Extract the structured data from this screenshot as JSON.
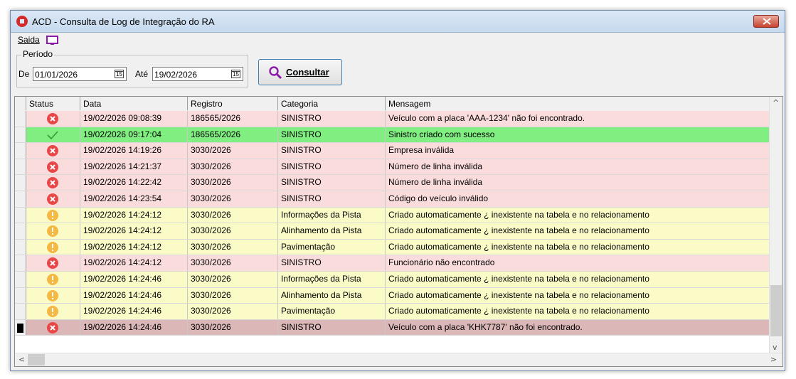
{
  "window": {
    "title": "ACD - Consulta de Log de Integração do RA"
  },
  "menu": {
    "saida_label": "Saida"
  },
  "periodo": {
    "label": "Período",
    "de_label": "De",
    "de_value": "01/01/2026",
    "ate_label": "Até",
    "ate_value": "19/02/2026",
    "calendar_icon_text": "15"
  },
  "consultar": {
    "label": "Consultar"
  },
  "grid": {
    "columns": [
      "Status",
      "Data",
      "Registro",
      "Categoria",
      "Mensagem"
    ],
    "rows": [
      {
        "status": "error",
        "data": "19/02/2026 09:08:39",
        "registro": "186565/2026",
        "categoria": "SINISTRO",
        "mensagem": "Veículo com a placa 'AAA-1234' não foi encontrado."
      },
      {
        "status": "success",
        "data": "19/02/2026 09:17:04",
        "registro": "186565/2026",
        "categoria": "SINISTRO",
        "mensagem": "Sinistro criado com sucesso"
      },
      {
        "status": "error",
        "data": "19/02/2026 14:19:26",
        "registro": "3030/2026",
        "categoria": "SINISTRO",
        "mensagem": "Empresa inválida"
      },
      {
        "status": "error",
        "data": "19/02/2026 14:21:37",
        "registro": "3030/2026",
        "categoria": "SINISTRO",
        "mensagem": "Número de linha inválida"
      },
      {
        "status": "error",
        "data": "19/02/2026 14:22:42",
        "registro": "3030/2026",
        "categoria": "SINISTRO",
        "mensagem": "Número de linha inválida"
      },
      {
        "status": "error",
        "data": "19/02/2026 14:23:54",
        "registro": "3030/2026",
        "categoria": "SINISTRO",
        "mensagem": "Código do veículo inválido"
      },
      {
        "status": "warning",
        "data": "19/02/2026 14:24:12",
        "registro": "3030/2026",
        "categoria": "Informações da Pista",
        "mensagem": "Criado automaticamente ¿ inexistente na tabela e no relacionamento"
      },
      {
        "status": "warning",
        "data": "19/02/2026 14:24:12",
        "registro": "3030/2026",
        "categoria": "Alinhamento da Pista",
        "mensagem": "Criado automaticamente ¿ inexistente na tabela e no relacionamento"
      },
      {
        "status": "warning",
        "data": "19/02/2026 14:24:12",
        "registro": "3030/2026",
        "categoria": "Pavimentação",
        "mensagem": "Criado automaticamente ¿ inexistente na tabela e no relacionamento"
      },
      {
        "status": "error",
        "data": "19/02/2026 14:24:12",
        "registro": "3030/2026",
        "categoria": "SINISTRO",
        "mensagem": "Funcionário não encontrado"
      },
      {
        "status": "warning",
        "data": "19/02/2026 14:24:46",
        "registro": "3030/2026",
        "categoria": "Informações da Pista",
        "mensagem": "Criado automaticamente ¿ inexistente na tabela e no relacionamento"
      },
      {
        "status": "warning",
        "data": "19/02/2026 14:24:46",
        "registro": "3030/2026",
        "categoria": "Alinhamento da Pista",
        "mensagem": "Criado automaticamente ¿ inexistente na tabela e no relacionamento"
      },
      {
        "status": "warning",
        "data": "19/02/2026 14:24:46",
        "registro": "3030/2026",
        "categoria": "Pavimentação",
        "mensagem": "Criado automaticamente ¿ inexistente na tabela e no relacionamento"
      },
      {
        "status": "error",
        "data": "19/02/2026 14:24:46",
        "registro": "3030/2026",
        "categoria": "SINISTRO",
        "mensagem": "Veículo com a placa 'KHK7787' não foi encontrado.",
        "selected": true
      }
    ]
  },
  "colors": {
    "error_row": "#fbdcdc",
    "success_row": "#80ee80",
    "warning_row": "#fbfbc8",
    "selected_row": "#dcb7b7"
  }
}
